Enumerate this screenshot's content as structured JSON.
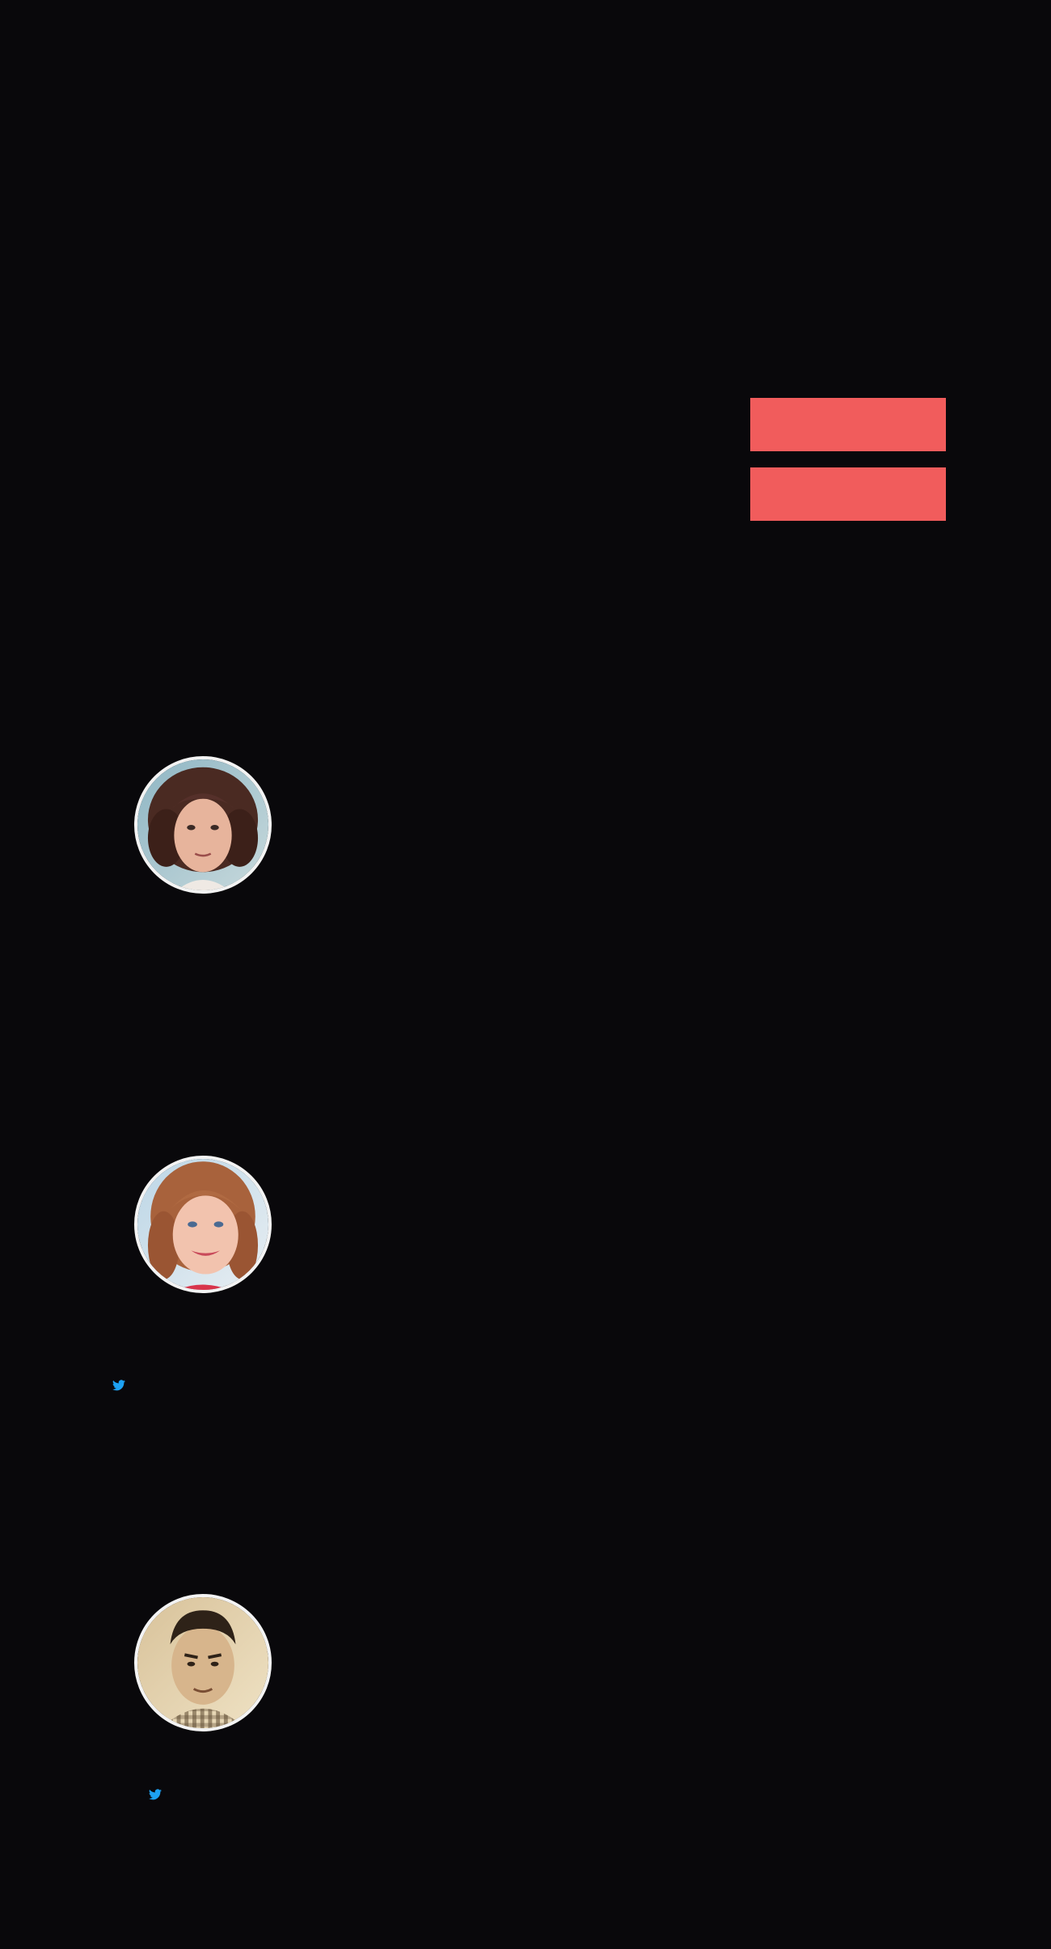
{
  "colors": {
    "background": "#09080b",
    "button_fill": "#f15c5c",
    "avatar_border": "#f3f3f3",
    "twitter_blue": "#1da1f2"
  },
  "hero": {
    "buttons": [
      {
        "icon": "none",
        "label": ""
      },
      {
        "icon": "none",
        "label": ""
      }
    ]
  },
  "team": {
    "members": [
      {
        "avatar": "avatar-woman-curly-hair",
        "social": []
      },
      {
        "avatar": "avatar-woman-blonde-hair",
        "social": [
          "twitter-icon"
        ]
      },
      {
        "avatar": "avatar-man-dark-hair",
        "social": [
          "twitter-icon"
        ]
      }
    ]
  }
}
